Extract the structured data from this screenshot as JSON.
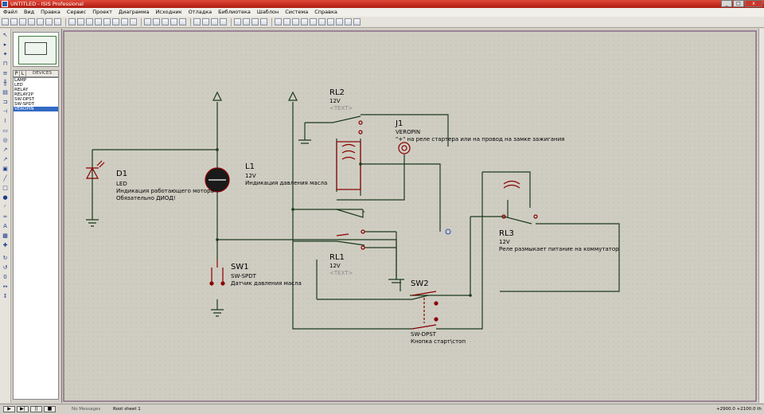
{
  "window": {
    "title": "UNTITLED - ISIS Professional"
  },
  "menu": [
    "Файл",
    "Вид",
    "Правка",
    "Сервис",
    "Проект",
    "Диаграмма",
    "Исходник",
    "Отладка",
    "Библиотека",
    "Шаблон",
    "Система",
    "Справка"
  ],
  "panel": {
    "tab_p": "P",
    "tab_l": "L",
    "title": "DEVICES"
  },
  "devices": [
    "LAMP",
    "LED",
    "RELAY",
    "RELAY2P",
    "SW-DPST",
    "SW-SPDT",
    "VEROPIN"
  ],
  "selected_device": "VEROPIN",
  "schematic": {
    "D1": {
      "ref": "D1",
      "type": "LED",
      "desc1": "Индикация работающего мотора",
      "desc2": "Обязательно ДИОД!"
    },
    "L1": {
      "ref": "L1",
      "value": "12V",
      "desc": "Индикация давления масла"
    },
    "RL2": {
      "ref": "RL2",
      "value": "12V",
      "text": "<TEXT>"
    },
    "J1": {
      "ref": "J1",
      "type": "VEROPIN",
      "desc": "\"+\" на реле стартера или на провод на замке зажигания"
    },
    "RL1": {
      "ref": "RL1",
      "value": "12V",
      "text": "<TEXT>"
    },
    "RL3": {
      "ref": "RL3",
      "value": "12V",
      "desc": "Реле размыкает питание на коммутатор"
    },
    "SW1": {
      "ref": "SW1",
      "type": "SW-SPDT",
      "desc": "Датчик давления масла"
    },
    "SW2": {
      "ref": "SW2",
      "type": "SW-DPST",
      "desc": "Кнопка старт\\стоп"
    }
  },
  "status": {
    "messages": "No Messages",
    "sheet": "Root sheet 1",
    "x": "+2900.0",
    "y": "+2100.0",
    "unit": "th"
  },
  "colors": {
    "wire": "#1b3a1b",
    "component": "#8b0000",
    "titlebar": "#c8382a",
    "selection": "#316ac5"
  }
}
